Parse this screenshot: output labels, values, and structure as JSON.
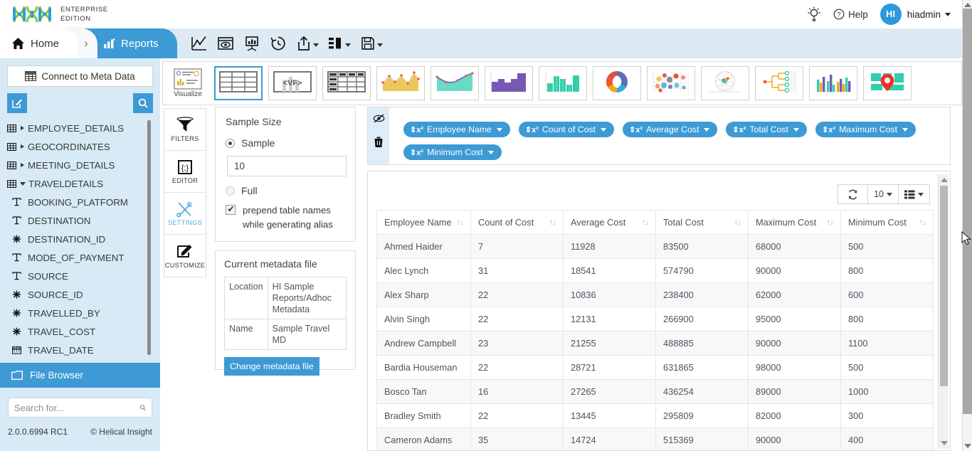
{
  "header": {
    "brand_line1": "ENTERPRISE",
    "brand_line2": "EDITION",
    "logo_icon": "dna-logo",
    "theme_icon": "lightbulb-icon",
    "help_label": "Help",
    "help_icon": "question-circle-icon",
    "avatar_initials": "HI",
    "user_name": "hiadmin"
  },
  "nav": {
    "home_label": "Home",
    "home_icon": "home-icon",
    "separator_icon": "chevron-right-icon",
    "active_label": "Reports",
    "active_icon": "bar-chart-icon",
    "toolbar": [
      {
        "name": "chart-line-icon",
        "label": "Chart"
      },
      {
        "name": "preview-eye-icon",
        "label": "Preview"
      },
      {
        "name": "presentation-icon",
        "label": "Dashboard"
      },
      {
        "name": "history-clock-icon",
        "label": "History"
      },
      {
        "name": "export-upload-icon",
        "label": "Export",
        "has_caret": true
      },
      {
        "name": "layout-columns-icon",
        "label": "Layout",
        "has_caret": true
      },
      {
        "name": "save-floppy-icon",
        "label": "Save",
        "has_caret": true
      }
    ]
  },
  "sidebar": {
    "connect_label": "Connect to Meta Data",
    "connect_icon": "grid-table-icon",
    "edit_icon": "edit-square-icon",
    "search_icon": "search-icon",
    "tree": [
      {
        "label": "EMPLOYEE_DETAILS",
        "icon": "table-icon",
        "expanded": false,
        "level": 0
      },
      {
        "label": "GEOCORDINATES",
        "icon": "table-icon",
        "expanded": false,
        "level": 0
      },
      {
        "label": "MEETING_DETAILS",
        "icon": "table-icon",
        "expanded": false,
        "level": 0
      },
      {
        "label": "TRAVELDETAILS",
        "icon": "table-icon",
        "expanded": true,
        "level": 0
      },
      {
        "label": "BOOKING_PLATFORM",
        "icon": "text-type-icon",
        "level": 1
      },
      {
        "label": "DESTINATION",
        "icon": "text-type-icon",
        "level": 1
      },
      {
        "label": "DESTINATION_ID",
        "icon": "number-type-icon",
        "level": 1
      },
      {
        "label": "MODE_OF_PAYMENT",
        "icon": "text-type-icon",
        "level": 1
      },
      {
        "label": "SOURCE",
        "icon": "text-type-icon",
        "level": 1
      },
      {
        "label": "SOURCE_ID",
        "icon": "number-type-icon",
        "level": 1
      },
      {
        "label": "TRAVELLED_BY",
        "icon": "number-type-icon",
        "level": 1
      },
      {
        "label": "TRAVEL_COST",
        "icon": "number-type-icon",
        "level": 1
      },
      {
        "label": "TRAVEL_DATE",
        "icon": "calendar-type-icon",
        "level": 1
      }
    ],
    "file_browser_label": "File Browser",
    "file_browser_icon": "folder-icon",
    "search_placeholder": "Search for...",
    "version": "2.0.0.6994 RC1",
    "copyright": "© Helical Insight"
  },
  "viz_strip": {
    "first_label": "Visualize",
    "first_icon": "visualize-icon",
    "selected_index": 0,
    "cards": [
      {
        "name": "table-chart-icon",
        "label": "Table"
      },
      {
        "name": "vf-chart-icon",
        "label": "VF"
      },
      {
        "name": "pivot-table-icon",
        "label": "Pivot Table"
      },
      {
        "name": "area-spline-chart-icon",
        "label": "Area Spline"
      },
      {
        "name": "smooth-area-chart-icon",
        "label": "Smooth Area"
      },
      {
        "name": "column-chart-icon",
        "label": "Column"
      },
      {
        "name": "bar-histogram-icon",
        "label": "Histogram"
      },
      {
        "name": "donut-chart-icon",
        "label": "Donut"
      },
      {
        "name": "bubble-scatter-icon",
        "label": "Bubble"
      },
      {
        "name": "circle-packing-icon",
        "label": "Circle Packing"
      },
      {
        "name": "dendrogram-icon",
        "label": "Dendrogram"
      },
      {
        "name": "grouped-bar-icon",
        "label": "Grouped Bar"
      },
      {
        "name": "map-marker-icon",
        "label": "Map"
      }
    ]
  },
  "tool_tabs": [
    {
      "label": "FILTERS",
      "icon": "funnel-icon",
      "active": false
    },
    {
      "label": "EDITOR",
      "icon": "code-braces-icon",
      "active": false
    },
    {
      "label": "SETTINGS",
      "icon": "tools-cross-icon",
      "active": true
    },
    {
      "label": "CUSTOMIZE",
      "icon": "customize-pen-icon",
      "active": false
    }
  ],
  "sample_panel": {
    "title": "Sample Size",
    "sample_label": "Sample",
    "sample_selected": true,
    "sample_value": "10",
    "full_label": "Full",
    "full_selected": false,
    "checkbox_checked": true,
    "checkbox_label_line1": "prepend table names",
    "checkbox_label_line2": "while generating alias"
  },
  "metadata_panel": {
    "title": "Current metadata file",
    "rows": [
      {
        "key": "Location",
        "value": "HI Sample Reports/Adhoc Metadata"
      },
      {
        "key": "Name",
        "value": "Sample Travel MD"
      }
    ],
    "button_label": "Change metadata file"
  },
  "pill_area": {
    "gutter_icons": [
      "hide-eye-icon",
      "trash-bin-icon"
    ],
    "pills": [
      {
        "label": "Employee Name",
        "sym": "⇕x²"
      },
      {
        "label": "Count of Cost",
        "sym": "⇕x²"
      },
      {
        "label": "Average Cost",
        "sym": "⇕x²"
      },
      {
        "label": "Total Cost",
        "sym": "⇕x²"
      },
      {
        "label": "Maximum Cost",
        "sym": "⇕x²"
      },
      {
        "label": "Minimum Cost",
        "sym": "⇕x²"
      }
    ]
  },
  "result_toolbar": {
    "refresh_icon": "refresh-icon",
    "page_size": "10",
    "columns_icon": "list-columns-icon"
  },
  "chart_data": {
    "type": "table",
    "title": "",
    "columns": [
      "Employee Name",
      "Count of Cost",
      "Average Cost",
      "Total Cost",
      "Maximum Cost",
      "Minimum Cost"
    ],
    "rows": [
      [
        "Ahmed Haider",
        "7",
        "11928",
        "83500",
        "68000",
        "500"
      ],
      [
        "Alec Lynch",
        "31",
        "18541",
        "574790",
        "90000",
        "800"
      ],
      [
        "Alex Sharp",
        "22",
        "10836",
        "238400",
        "62000",
        "600"
      ],
      [
        "Alvin Singh",
        "22",
        "12131",
        "266900",
        "95000",
        "800"
      ],
      [
        "Andrew Campbell",
        "23",
        "21255",
        "488885",
        "90000",
        "1100"
      ],
      [
        "Bardia Houseman",
        "22",
        "28721",
        "631865",
        "98000",
        "500"
      ],
      [
        "Bosco Tan",
        "16",
        "27265",
        "436254",
        "89000",
        "1000"
      ],
      [
        "Bradley Smith",
        "22",
        "13445",
        "295809",
        "82000",
        "300"
      ],
      [
        "Cameron Adams",
        "35",
        "14724",
        "515369",
        "90000",
        "400"
      ]
    ],
    "sort_indicator": "↑↓"
  },
  "colors": {
    "accent": "#3d9ad4",
    "sidebar_bg": "#d7eaf5",
    "nav_bg": "#ddeaf3",
    "pill_bg": "#3d9ad4"
  }
}
